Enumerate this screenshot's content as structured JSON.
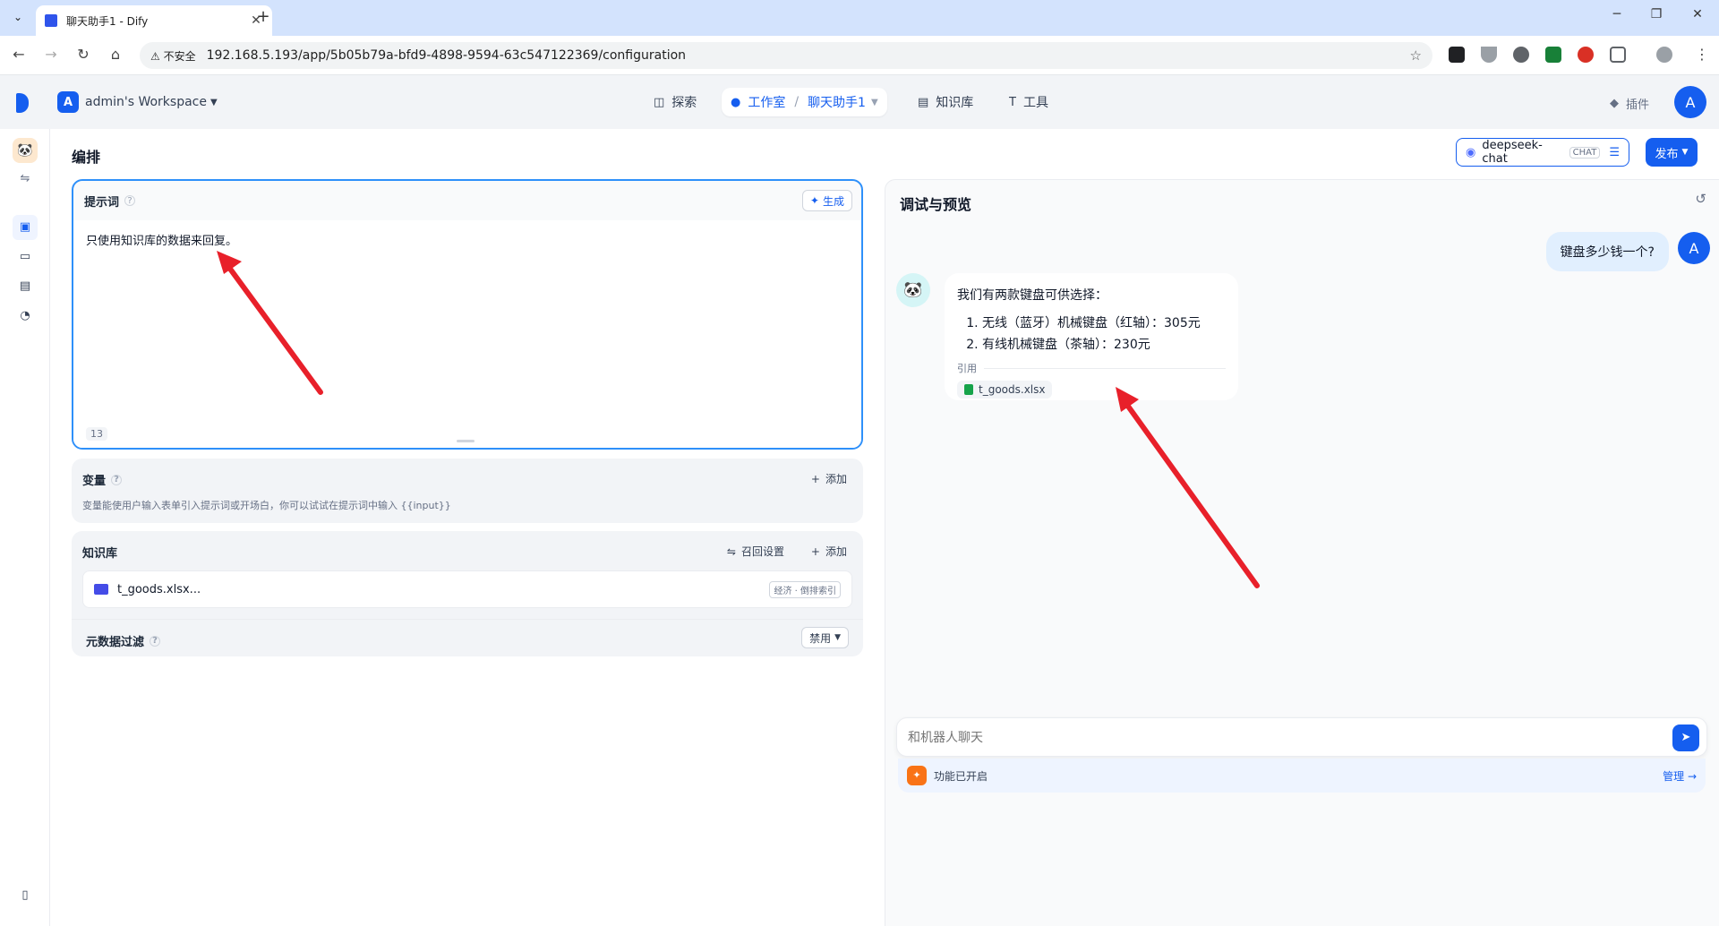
{
  "browser": {
    "tab_title": "聊天助手1 - Dify",
    "security_label": "不安全",
    "url": "192.168.5.193/app/5b05b79a-bfd9-4898-9594-63c547122369/configuration",
    "extension_colors": [
      "#202124",
      "#5f6368",
      "#5f6368",
      "#188038",
      "#d93025",
      "#5f6368"
    ]
  },
  "header": {
    "workspace_badge": "A",
    "workspace_name": "admin's Workspace",
    "nav": {
      "explore": "探索",
      "studio": "工作室",
      "app_name": "聊天助手1",
      "knowledge": "知识库",
      "tools": "工具"
    },
    "plugins": "插件",
    "avatar": "A"
  },
  "page": {
    "title": "编排",
    "model": {
      "name": "deepseek-chat",
      "mode": "CHAT"
    },
    "publish": "发布"
  },
  "prompt": {
    "label": "提示词",
    "generate": "生成",
    "text": "只使用知识库的数据来回复。",
    "char_count": "13"
  },
  "variables": {
    "label": "变量",
    "add": "添加",
    "description": "变量能使用户输入表单引入提示词或开场白，你可以试试在提示词中输入 {{input}}"
  },
  "knowledge": {
    "label": "知识库",
    "recall_settings": "召回设置",
    "add": "添加",
    "items": [
      {
        "name": "t_goods.xlsx...",
        "tag": "经济 · 倒排索引"
      }
    ],
    "metadata_filter": {
      "label": "元数据过滤",
      "value": "禁用"
    }
  },
  "debug": {
    "title": "调试与预览",
    "user_avatar": "A",
    "user_message": "键盘多少钱一个?",
    "bot_intro": "我们有两款键盘可供选择：",
    "bot_items": [
      "无线（蓝牙）机械键盘（红轴）：305元",
      "有线机械键盘（茶轴）：230元"
    ],
    "citation_label": "引用",
    "citation_file": "t_goods.xlsx",
    "input_placeholder": "和机器人聊天",
    "features_enabled": "功能已开启",
    "manage": "管理"
  }
}
